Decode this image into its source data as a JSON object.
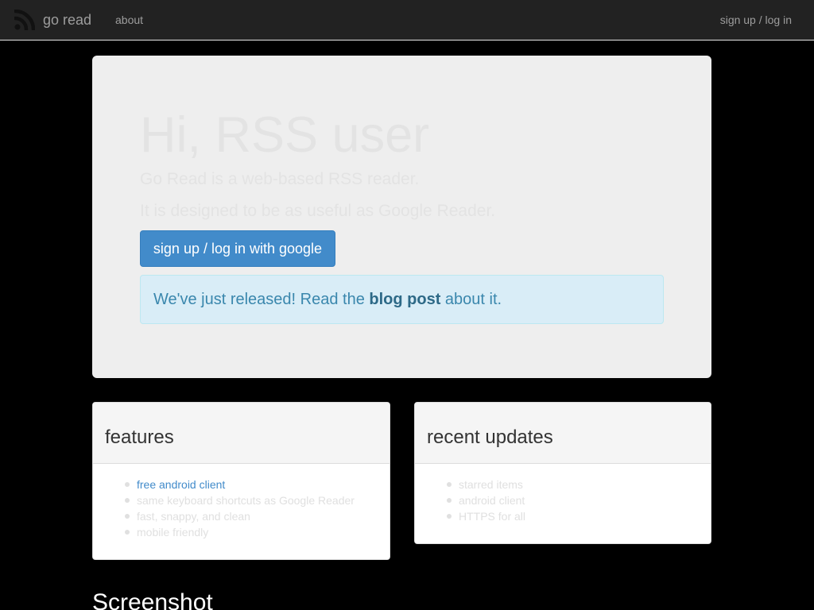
{
  "nav": {
    "brand": "go read",
    "about": "about",
    "signup": "sign up / log in"
  },
  "hero": {
    "title": "Hi, RSS user",
    "line1": "Go Read is a web-based RSS reader.",
    "line2": "It is designed to be as useful as Google Reader.",
    "button": "sign up / log in with google",
    "alert": {
      "prefix": "We've just released! Read the ",
      "link": "blog post",
      "suffix": " about it."
    }
  },
  "features": {
    "title": "features",
    "items": [
      "free android client",
      "same keyboard shortcuts as Google Reader",
      "fast, snappy, and clean",
      "mobile friendly"
    ]
  },
  "updates": {
    "title": "recent updates",
    "items": [
      "starred items",
      "android client",
      "HTTPS for all"
    ]
  },
  "screenshot_heading": "Screenshot",
  "colors": {
    "primary": "#428bca",
    "navbar": "#222222",
    "alert_bg": "#d9edf7",
    "alert_text": "#3a87ad"
  }
}
